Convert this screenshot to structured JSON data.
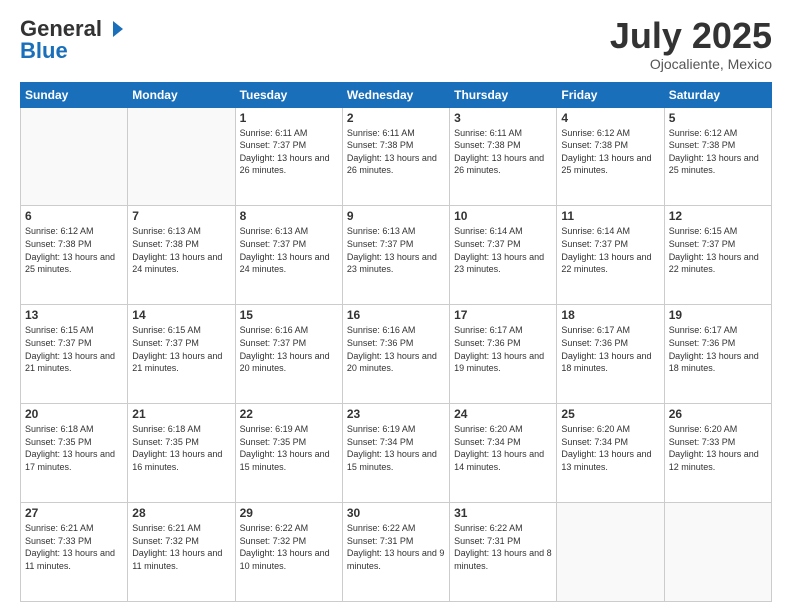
{
  "header": {
    "logo_general": "General",
    "logo_blue": "Blue",
    "main_title": "July 2025",
    "subtitle": "Ojocaliente, Mexico"
  },
  "calendar": {
    "days_of_week": [
      "Sunday",
      "Monday",
      "Tuesday",
      "Wednesday",
      "Thursday",
      "Friday",
      "Saturday"
    ],
    "weeks": [
      [
        {
          "day": "",
          "sunrise": "",
          "sunset": "",
          "daylight": ""
        },
        {
          "day": "",
          "sunrise": "",
          "sunset": "",
          "daylight": ""
        },
        {
          "day": "1",
          "sunrise": "Sunrise: 6:11 AM",
          "sunset": "Sunset: 7:37 PM",
          "daylight": "Daylight: 13 hours and 26 minutes."
        },
        {
          "day": "2",
          "sunrise": "Sunrise: 6:11 AM",
          "sunset": "Sunset: 7:38 PM",
          "daylight": "Daylight: 13 hours and 26 minutes."
        },
        {
          "day": "3",
          "sunrise": "Sunrise: 6:11 AM",
          "sunset": "Sunset: 7:38 PM",
          "daylight": "Daylight: 13 hours and 26 minutes."
        },
        {
          "day": "4",
          "sunrise": "Sunrise: 6:12 AM",
          "sunset": "Sunset: 7:38 PM",
          "daylight": "Daylight: 13 hours and 25 minutes."
        },
        {
          "day": "5",
          "sunrise": "Sunrise: 6:12 AM",
          "sunset": "Sunset: 7:38 PM",
          "daylight": "Daylight: 13 hours and 25 minutes."
        }
      ],
      [
        {
          "day": "6",
          "sunrise": "Sunrise: 6:12 AM",
          "sunset": "Sunset: 7:38 PM",
          "daylight": "Daylight: 13 hours and 25 minutes."
        },
        {
          "day": "7",
          "sunrise": "Sunrise: 6:13 AM",
          "sunset": "Sunset: 7:38 PM",
          "daylight": "Daylight: 13 hours and 24 minutes."
        },
        {
          "day": "8",
          "sunrise": "Sunrise: 6:13 AM",
          "sunset": "Sunset: 7:37 PM",
          "daylight": "Daylight: 13 hours and 24 minutes."
        },
        {
          "day": "9",
          "sunrise": "Sunrise: 6:13 AM",
          "sunset": "Sunset: 7:37 PM",
          "daylight": "Daylight: 13 hours and 23 minutes."
        },
        {
          "day": "10",
          "sunrise": "Sunrise: 6:14 AM",
          "sunset": "Sunset: 7:37 PM",
          "daylight": "Daylight: 13 hours and 23 minutes."
        },
        {
          "day": "11",
          "sunrise": "Sunrise: 6:14 AM",
          "sunset": "Sunset: 7:37 PM",
          "daylight": "Daylight: 13 hours and 22 minutes."
        },
        {
          "day": "12",
          "sunrise": "Sunrise: 6:15 AM",
          "sunset": "Sunset: 7:37 PM",
          "daylight": "Daylight: 13 hours and 22 minutes."
        }
      ],
      [
        {
          "day": "13",
          "sunrise": "Sunrise: 6:15 AM",
          "sunset": "Sunset: 7:37 PM",
          "daylight": "Daylight: 13 hours and 21 minutes."
        },
        {
          "day": "14",
          "sunrise": "Sunrise: 6:15 AM",
          "sunset": "Sunset: 7:37 PM",
          "daylight": "Daylight: 13 hours and 21 minutes."
        },
        {
          "day": "15",
          "sunrise": "Sunrise: 6:16 AM",
          "sunset": "Sunset: 7:37 PM",
          "daylight": "Daylight: 13 hours and 20 minutes."
        },
        {
          "day": "16",
          "sunrise": "Sunrise: 6:16 AM",
          "sunset": "Sunset: 7:36 PM",
          "daylight": "Daylight: 13 hours and 20 minutes."
        },
        {
          "day": "17",
          "sunrise": "Sunrise: 6:17 AM",
          "sunset": "Sunset: 7:36 PM",
          "daylight": "Daylight: 13 hours and 19 minutes."
        },
        {
          "day": "18",
          "sunrise": "Sunrise: 6:17 AM",
          "sunset": "Sunset: 7:36 PM",
          "daylight": "Daylight: 13 hours and 18 minutes."
        },
        {
          "day": "19",
          "sunrise": "Sunrise: 6:17 AM",
          "sunset": "Sunset: 7:36 PM",
          "daylight": "Daylight: 13 hours and 18 minutes."
        }
      ],
      [
        {
          "day": "20",
          "sunrise": "Sunrise: 6:18 AM",
          "sunset": "Sunset: 7:35 PM",
          "daylight": "Daylight: 13 hours and 17 minutes."
        },
        {
          "day": "21",
          "sunrise": "Sunrise: 6:18 AM",
          "sunset": "Sunset: 7:35 PM",
          "daylight": "Daylight: 13 hours and 16 minutes."
        },
        {
          "day": "22",
          "sunrise": "Sunrise: 6:19 AM",
          "sunset": "Sunset: 7:35 PM",
          "daylight": "Daylight: 13 hours and 15 minutes."
        },
        {
          "day": "23",
          "sunrise": "Sunrise: 6:19 AM",
          "sunset": "Sunset: 7:34 PM",
          "daylight": "Daylight: 13 hours and 15 minutes."
        },
        {
          "day": "24",
          "sunrise": "Sunrise: 6:20 AM",
          "sunset": "Sunset: 7:34 PM",
          "daylight": "Daylight: 13 hours and 14 minutes."
        },
        {
          "day": "25",
          "sunrise": "Sunrise: 6:20 AM",
          "sunset": "Sunset: 7:34 PM",
          "daylight": "Daylight: 13 hours and 13 minutes."
        },
        {
          "day": "26",
          "sunrise": "Sunrise: 6:20 AM",
          "sunset": "Sunset: 7:33 PM",
          "daylight": "Daylight: 13 hours and 12 minutes."
        }
      ],
      [
        {
          "day": "27",
          "sunrise": "Sunrise: 6:21 AM",
          "sunset": "Sunset: 7:33 PM",
          "daylight": "Daylight: 13 hours and 11 minutes."
        },
        {
          "day": "28",
          "sunrise": "Sunrise: 6:21 AM",
          "sunset": "Sunset: 7:32 PM",
          "daylight": "Daylight: 13 hours and 11 minutes."
        },
        {
          "day": "29",
          "sunrise": "Sunrise: 6:22 AM",
          "sunset": "Sunset: 7:32 PM",
          "daylight": "Daylight: 13 hours and 10 minutes."
        },
        {
          "day": "30",
          "sunrise": "Sunrise: 6:22 AM",
          "sunset": "Sunset: 7:31 PM",
          "daylight": "Daylight: 13 hours and 9 minutes."
        },
        {
          "day": "31",
          "sunrise": "Sunrise: 6:22 AM",
          "sunset": "Sunset: 7:31 PM",
          "daylight": "Daylight: 13 hours and 8 minutes."
        },
        {
          "day": "",
          "sunrise": "",
          "sunset": "",
          "daylight": ""
        },
        {
          "day": "",
          "sunrise": "",
          "sunset": "",
          "daylight": ""
        }
      ]
    ]
  }
}
